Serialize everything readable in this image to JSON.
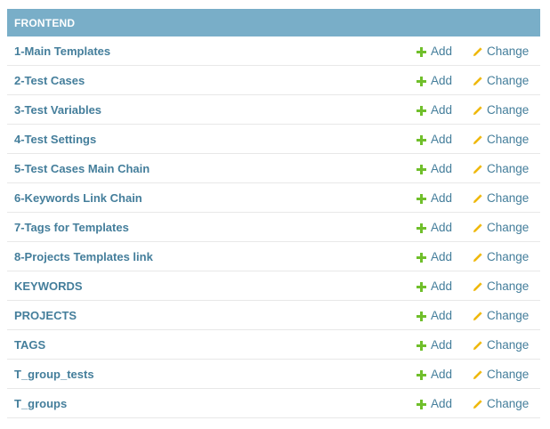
{
  "module": {
    "caption": "FRONTEND",
    "caption_color": "#79aec8",
    "link_color": "#447e9b",
    "add_icon_color": "#70bf2b",
    "change_icon_color": "#efb80b",
    "add_icon": "plus-icon",
    "change_icon": "pencil-icon",
    "add_label": "Add",
    "change_label": "Change",
    "rows": [
      "1-Main Templates",
      "2-Test Cases",
      "3-Test Variables",
      "4-Test Settings",
      "5-Test Cases Main Chain",
      "6-Keywords Link Chain",
      "7-Tags for Templates",
      "8-Projects Templates link",
      "KEYWORDS",
      "PROJECTS",
      "TAGS",
      "T_group_tests",
      "T_groups"
    ]
  }
}
